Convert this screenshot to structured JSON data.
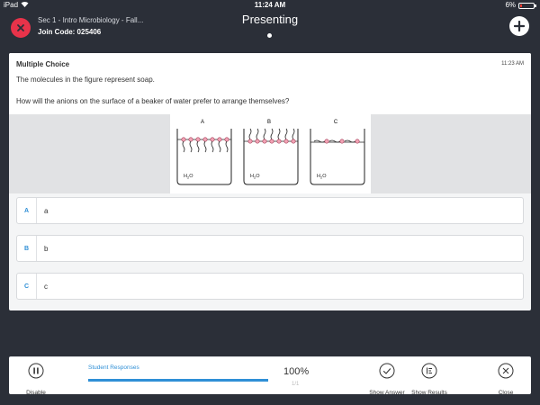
{
  "status_bar": {
    "device": "iPad",
    "time": "11:24 AM",
    "battery": "6%",
    "battery_level": 0.06
  },
  "header": {
    "course": "Sec 1 - Intro Microbiology - Fall...",
    "join_code": "Join Code: 025406",
    "title": "Presenting"
  },
  "question": {
    "type": "Multiple Choice",
    "time": "11:23 AM",
    "line1": "The molecules in the figure represent soap.",
    "line2": "How will the anions on the surface of a beaker of water prefer to arrange themselves?",
    "figure": {
      "beakers": [
        {
          "label": "A",
          "water": "H2O"
        },
        {
          "label": "B",
          "water": "H2O"
        },
        {
          "label": "C",
          "water": "H2O"
        }
      ]
    }
  },
  "answers": [
    {
      "letter": "A",
      "text": "a"
    },
    {
      "letter": "B",
      "text": "b"
    },
    {
      "letter": "C",
      "text": "c"
    }
  ],
  "toolbar": {
    "disable": "Disable",
    "responses_label": "Student Responses",
    "percent": "100%",
    "fraction": "1/1",
    "progress": 1.0,
    "show_answer": "Show Answer",
    "show_results": "Show Results",
    "close": "Close"
  },
  "colors": {
    "accent": "#2f8fd6",
    "danger": "#e8334a",
    "background": "#2b2f38"
  }
}
